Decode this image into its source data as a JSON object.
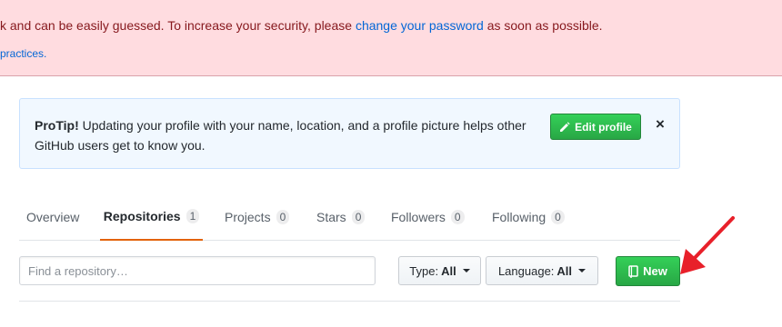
{
  "security_warning": {
    "line1_prefix": "k and can be easily guessed. To increase your security, please ",
    "line1_link": "change your password",
    "line1_suffix": " as soon as possible.",
    "line2_link": "practices."
  },
  "protip": {
    "label": "ProTip!",
    "text": " Updating your profile with your name, location, and a profile picture helps other GitHub users get to know you.",
    "edit_button": "Edit profile",
    "close_icon": "×"
  },
  "tabs": [
    {
      "label": "Overview",
      "count": null
    },
    {
      "label": "Repositories",
      "count": "1"
    },
    {
      "label": "Projects",
      "count": "0"
    },
    {
      "label": "Stars",
      "count": "0"
    },
    {
      "label": "Followers",
      "count": "0"
    },
    {
      "label": "Following",
      "count": "0"
    }
  ],
  "repo_filter": {
    "search_placeholder": "Find a repository…",
    "type_label": "Type:",
    "type_value": "All",
    "language_label": "Language:",
    "language_value": "All",
    "new_button": "New"
  },
  "colors": {
    "warning_bg": "#ffdce0",
    "warning_text": "#86181d",
    "link": "#0366d6",
    "primary_button": "#28a745",
    "active_tab_underline": "#e36209",
    "annotation_arrow": "#e8202a"
  },
  "icons": {
    "edit": "pencil-icon",
    "new": "repo-book-icon",
    "dropdown": "caret-down-icon",
    "close": "close-icon"
  }
}
